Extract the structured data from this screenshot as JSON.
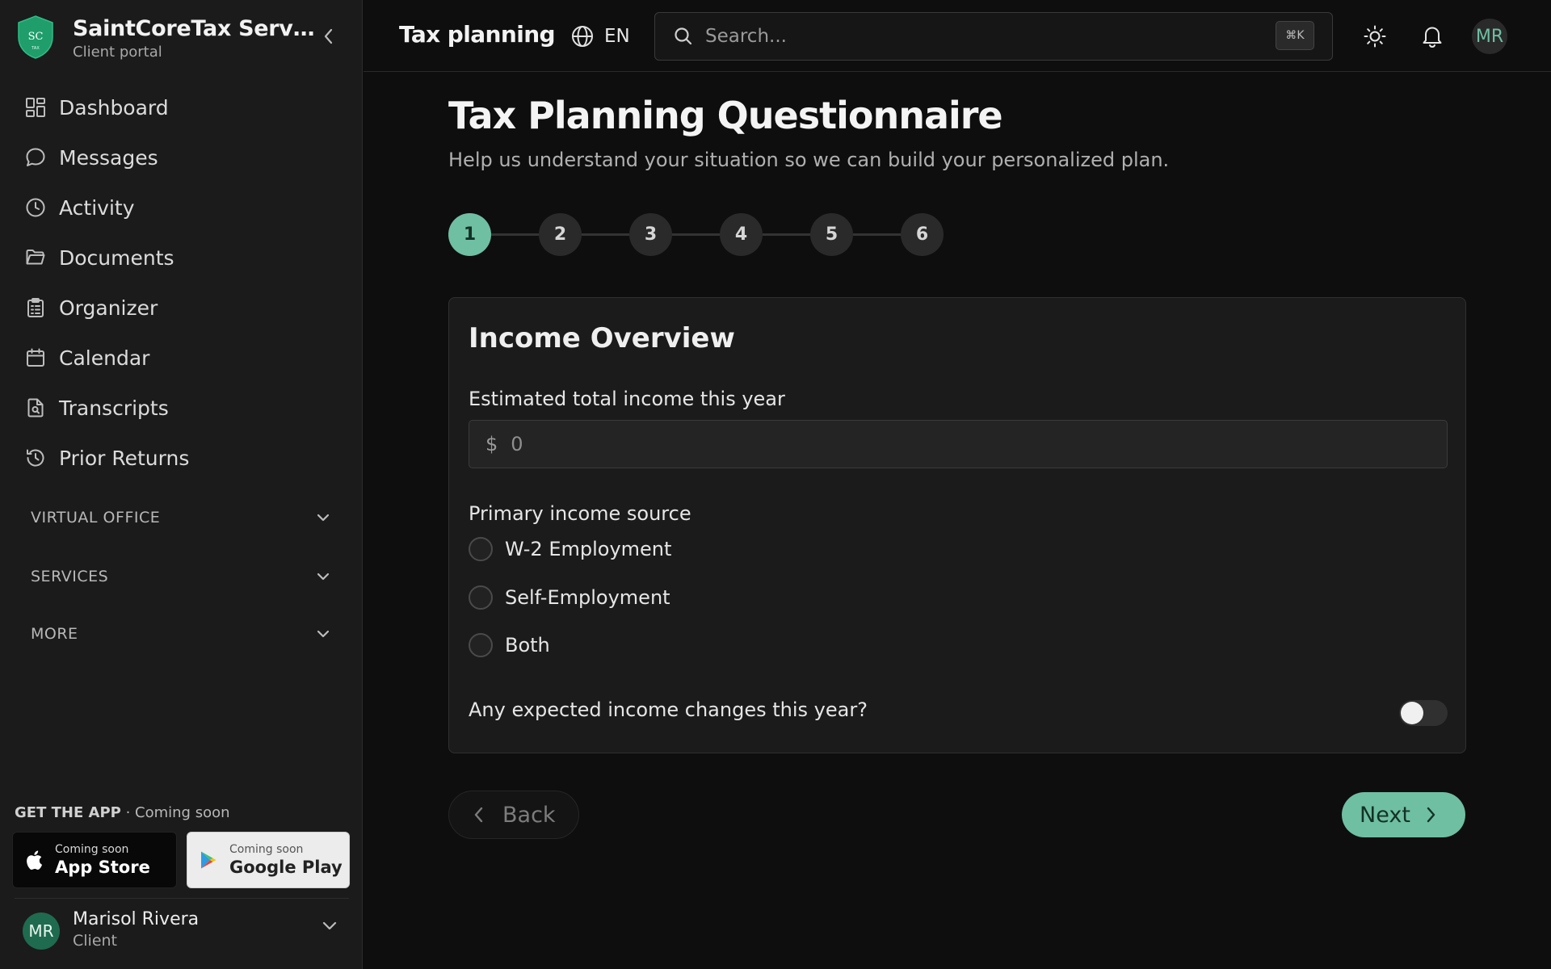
{
  "brand": {
    "initials": "SC",
    "tagline": "TAX",
    "name": "SaintCoreTax Services",
    "subtitle": "Client portal"
  },
  "sidebar": {
    "items": [
      {
        "label": "Dashboard",
        "icon": "grid-icon"
      },
      {
        "label": "Messages",
        "icon": "chat-bubble-icon"
      },
      {
        "label": "Activity",
        "icon": "clock-icon"
      },
      {
        "label": "Documents",
        "icon": "folder-icon"
      },
      {
        "label": "Organizer",
        "icon": "clipboard-icon"
      },
      {
        "label": "Calendar",
        "icon": "calendar-icon"
      },
      {
        "label": "Transcripts",
        "icon": "file-search-icon"
      },
      {
        "label": "Prior Returns",
        "icon": "history-icon"
      }
    ],
    "sections": [
      {
        "label": "VIRTUAL OFFICE"
      },
      {
        "label": "SERVICES"
      },
      {
        "label": "MORE"
      }
    ],
    "get_app": {
      "title": "GET THE APP",
      "note": "· Coming soon"
    },
    "stores": {
      "apple": {
        "small": "Coming soon",
        "big": "App Store",
        "icon": "apple-icon"
      },
      "google": {
        "small": "Coming soon",
        "big": "Google Play",
        "icon": "google-play-icon"
      }
    },
    "user": {
      "initials": "MR",
      "name": "Marisol Rivera",
      "role": "Client"
    }
  },
  "header": {
    "title": "Tax planning",
    "language": "EN",
    "search_placeholder": "Search...",
    "search_shortcut": "⌘K",
    "avatar_initials": "MR"
  },
  "main": {
    "title": "Tax Planning Questionnaire",
    "subtitle": "Help us understand your situation so we can build your personalized plan.",
    "steps": [
      "1",
      "2",
      "3",
      "4",
      "5",
      "6"
    ],
    "active_step": 1,
    "card": {
      "title": "Income Overview",
      "income_label": "Estimated total income this year",
      "currency": "$",
      "income_placeholder": "0",
      "source_label": "Primary income source",
      "source_options": [
        "W-2 Employment",
        "Self-Employment",
        "Both"
      ],
      "changes_label": "Any expected income changes this year?",
      "changes_value": false
    },
    "back_label": "Back",
    "next_label": "Next"
  },
  "colors": {
    "accent": "#6fbfa3",
    "brand_green": "#1f9d6a",
    "background": "#0e0e0e",
    "sidebar": "#1b1b1b",
    "card": "#1b1b1b"
  }
}
